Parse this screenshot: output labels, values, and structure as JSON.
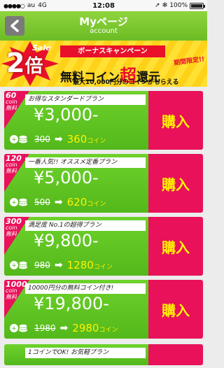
{
  "status_bar": {
    "carrier": "au",
    "network": "4G",
    "time": "12:08",
    "battery": "100%"
  },
  "header": {
    "title": "Myページ",
    "subtitle": "account"
  },
  "banner": {
    "sale": "Sale",
    "multiplier": "2",
    "multiplier_unit": "倍",
    "campaign": "ボーナスキャンペーン",
    "limited": "期間限定!!",
    "main_prefix": "無料コイン",
    "main_emph": "超",
    "main_suffix": "還元",
    "detail": "最大10,000円分のコインがもらえる"
  },
  "plans": [
    {
      "corner_num": "60",
      "corner_unit": "coin",
      "corner_label": "無料",
      "name": "お得なスタンダードプラン",
      "price": "¥3,000-",
      "coin_before": "300",
      "coin_after": "360",
      "coin_unit": "コイン",
      "buy_label": "購入"
    },
    {
      "corner_num": "120",
      "corner_unit": "coin",
      "corner_label": "無料",
      "name": "一番人気!! オススメ定番プラン",
      "price": "¥5,000-",
      "coin_before": "500",
      "coin_after": "620",
      "coin_unit": "コイン",
      "buy_label": "購入"
    },
    {
      "corner_num": "300",
      "corner_unit": "coin",
      "corner_label": "無料",
      "name": "満足度 No.1の超得プラン",
      "price": "¥9,800-",
      "coin_before": "980",
      "coin_after": "1280",
      "coin_unit": "コイン",
      "buy_label": "購入"
    },
    {
      "corner_num": "1000",
      "corner_unit": "coin",
      "corner_label": "無料",
      "name": "10000円分の無料コイン付き!",
      "price": "¥19,800-",
      "coin_before": "1980",
      "coin_after": "2980",
      "coin_unit": "コイン",
      "buy_label": "購入"
    }
  ],
  "partial_plan": {
    "name": "1コインでOK! お気軽プラン"
  },
  "colors": {
    "header_green": "#6cbc24",
    "plan_green": "#53b81a",
    "buy_pink": "#e8115a",
    "buy_text_yellow": "#fff200",
    "banner_yellow": "#ffd21a",
    "accent_red": "#e8102a"
  }
}
